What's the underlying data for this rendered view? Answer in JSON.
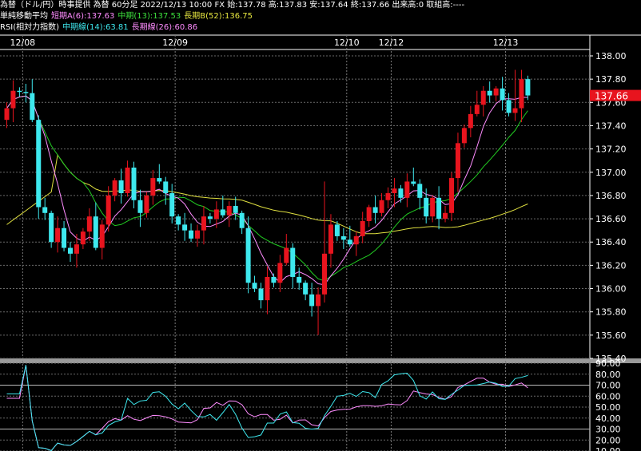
{
  "header": {
    "line1": "為替（ドル/円）時事提供 為替 60分足 2022/12/13 10:00 FX 始:137.78 高:137.83 安:137.64 終:137.66 出来高:0 取組高:----",
    "ma_title": "単純移動平均",
    "ma_short": "短期A(6):137.63",
    "ma_mid": "中期(13):137.53",
    "ma_long": "長期B(52):136.75",
    "rsi_title": "RSI(相対力指数)",
    "rsi_mid": "中期線(14):63.81",
    "rsi_long": "長期線(26):60.86"
  },
  "colors": {
    "up": "#e8141e",
    "down": "#3ee8ee",
    "ma_short": "#ff8cff",
    "ma_mid": "#22cc22",
    "ma_long": "#e0e040",
    "rsi_mid": "#3ee8ee",
    "rsi_long": "#ff8cff",
    "price_tag": "#e8141e"
  },
  "chart_data": [
    {
      "type": "candlestick",
      "x_labels": [
        {
          "label": "12/08",
          "index": 3
        },
        {
          "label": "12/09",
          "index": 27
        },
        {
          "label": "12/10",
          "index": 54
        },
        {
          "label": "12/12",
          "index": 61
        },
        {
          "label": "12/13",
          "index": 79
        }
      ],
      "ylim": [
        135.4,
        138.0
      ],
      "y_ticks": [
        "138.00",
        "137.80",
        "137.60",
        "137.40",
        "137.20",
        "137.00",
        "136.80",
        "136.60",
        "136.40",
        "136.20",
        "136.00",
        "135.80",
        "135.60",
        "135.40"
      ],
      "last_price": "137.66",
      "series_legend": [
        "短期A(6)",
        "中期(13)",
        "長期B(52)"
      ],
      "closes": [
        137.55,
        137.7,
        137.69,
        137.68,
        137.45,
        136.7,
        136.65,
        136.4,
        136.52,
        136.35,
        136.3,
        136.38,
        136.49,
        136.62,
        136.35,
        136.55,
        136.8,
        136.93,
        136.82,
        137.04,
        136.76,
        136.65,
        136.8,
        136.95,
        136.92,
        136.82,
        136.62,
        136.55,
        136.5,
        136.43,
        136.5,
        136.62,
        136.6,
        136.68,
        136.63,
        136.71,
        136.65,
        136.52,
        136.05,
        136.0,
        135.9,
        136.1,
        136.05,
        136.22,
        136.35,
        136.1,
        136.05,
        135.95,
        135.85,
        135.95,
        136.3,
        136.55,
        136.45,
        136.42,
        136.38,
        136.45,
        136.58,
        136.7,
        136.65,
        136.76,
        136.82,
        136.86,
        136.78,
        136.92,
        136.9,
        136.78,
        136.62,
        136.78,
        136.6,
        136.65,
        136.95,
        137.25,
        137.38,
        137.5,
        137.58,
        137.7,
        137.66,
        137.72,
        137.62,
        137.51,
        137.55,
        137.8,
        137.66
      ]
    },
    {
      "type": "line",
      "name": "RSI",
      "ylim": [
        10,
        90
      ],
      "y_ticks": [
        "90.00",
        "80.00",
        "70.00",
        "60.00",
        "50.00",
        "40.00",
        "30.00",
        "20.00",
        "10.00"
      ],
      "series_legend": [
        "中期線(14)",
        "長期線(26)"
      ]
    }
  ]
}
